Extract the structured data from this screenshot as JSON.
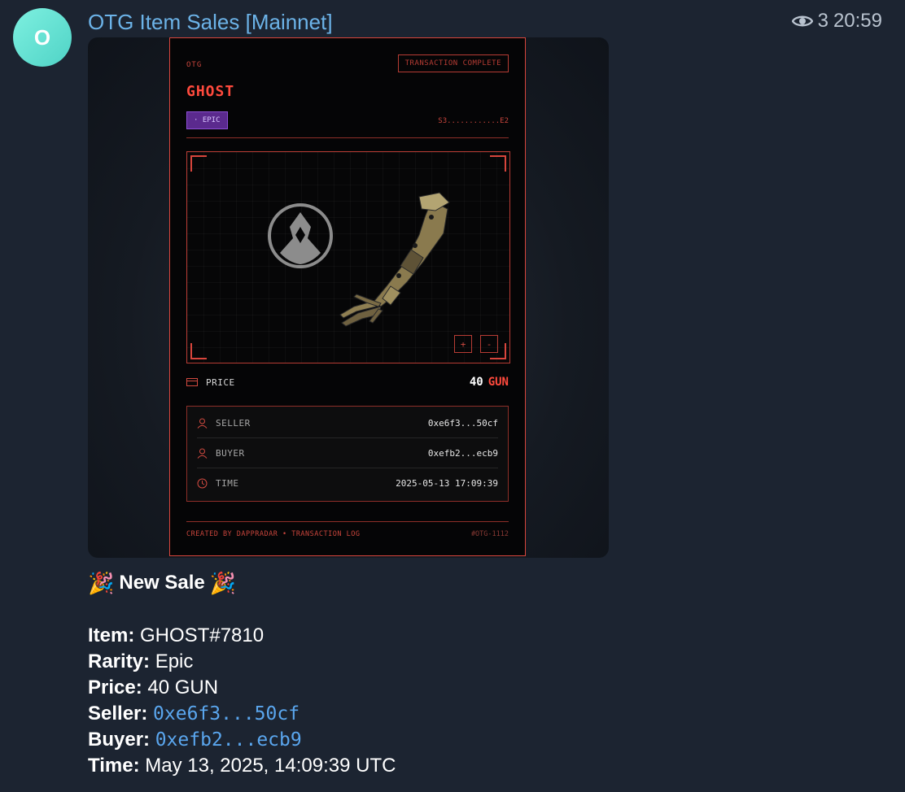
{
  "header": {
    "avatar_letter": "O",
    "channel_name": "OTG Item Sales [Mainnet]",
    "views": "3",
    "time": "20:59"
  },
  "card": {
    "brand": "OTG",
    "status_badge": "TRANSACTION COMPLETE",
    "item_name": "GHOST",
    "rarity_badge": "· EPIC",
    "season": "S3............E2",
    "zoom_in": "+",
    "zoom_out": "-",
    "price_label": "PRICE",
    "price_value": "40",
    "price_currency": "GUN",
    "seller_label": "SELLER",
    "seller_value": "0xe6f3...50cf",
    "buyer_label": "BUYER",
    "buyer_value": "0xefb2...ecb9",
    "time_label": "TIME",
    "time_value": "2025-05-13 17:09:39",
    "footer_left": "CREATED BY DAPPRADAR • TRANSACTION LOG",
    "footer_right": "#OTG-1112",
    "colors": {
      "accent": "#ff4a3d",
      "frame": "#d8453c",
      "rarity": "#5b2a8e"
    }
  },
  "message": {
    "party_emoji": "🎉",
    "headline": "New Sale",
    "item_key": "Item:",
    "item_val": "GHOST#7810",
    "rarity_key": "Rarity:",
    "rarity_val": "Epic",
    "price_key": "Price:",
    "price_val": "40 GUN",
    "seller_key": "Seller:",
    "seller_val": "0xe6f3...50cf",
    "buyer_key": "Buyer:",
    "buyer_val": "0xefb2...ecb9",
    "time_key": "Time:",
    "time_val": "May 13, 2025, 14:09:39 UTC"
  }
}
